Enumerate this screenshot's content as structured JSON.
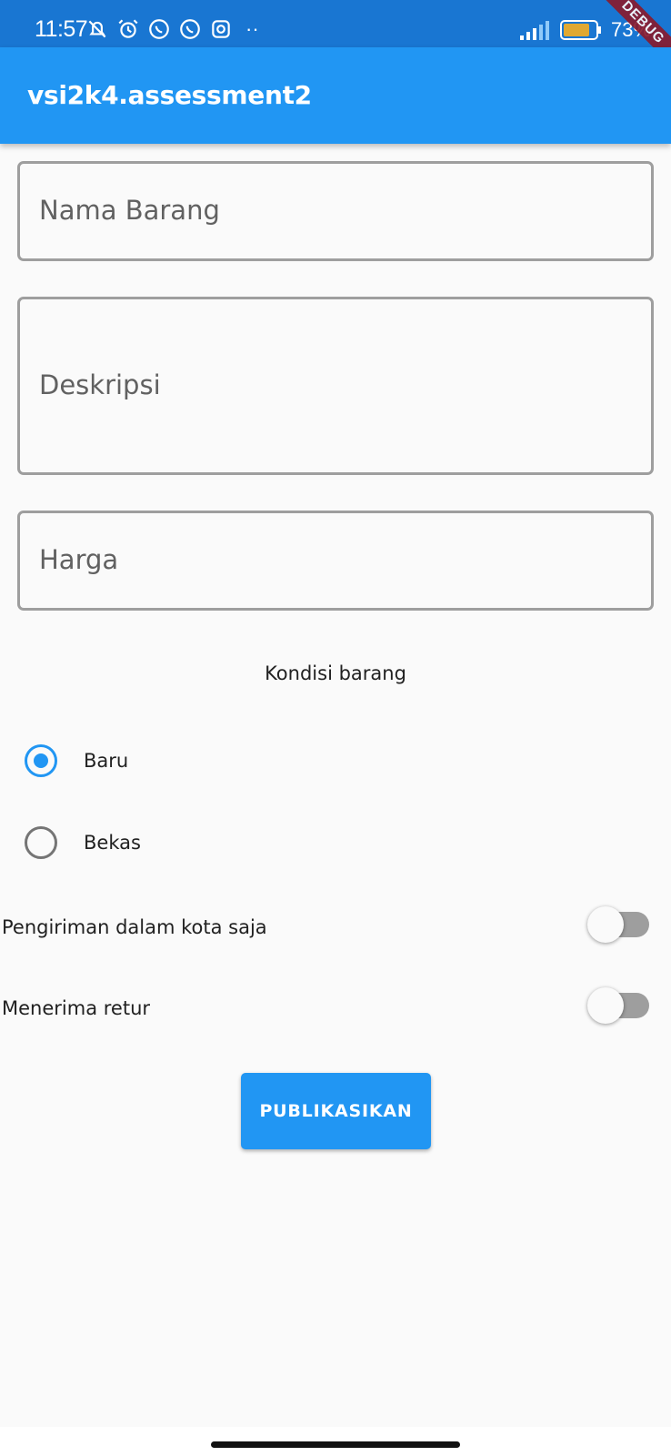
{
  "status_bar": {
    "time": "11:57",
    "notification_icons": [
      "bell-off-icon",
      "alarm-icon",
      "whatsapp-icon",
      "whatsapp-icon",
      "instagram-icon"
    ],
    "more": "··",
    "battery_percent": "73%",
    "debug_banner": "DEBUG"
  },
  "app_bar": {
    "title": "vsi2k4.assessment2"
  },
  "form": {
    "name_label": "Nama Barang",
    "description_label": "Deskripsi",
    "price_label": "Harga",
    "condition_heading": "Kondisi barang",
    "conditions": [
      {
        "label": "Baru",
        "checked": true
      },
      {
        "label": "Bekas",
        "checked": false
      }
    ],
    "toggles": [
      {
        "label": "Pengiriman dalam kota saja",
        "on": false
      },
      {
        "label": "Menerima retur",
        "on": false
      }
    ],
    "publish_label": "PUBLIKASIKAN"
  },
  "colors": {
    "primary": "#2196f3",
    "status_bar": "#1976d2",
    "background": "#fafafa",
    "debug": "#8b1a2b"
  }
}
